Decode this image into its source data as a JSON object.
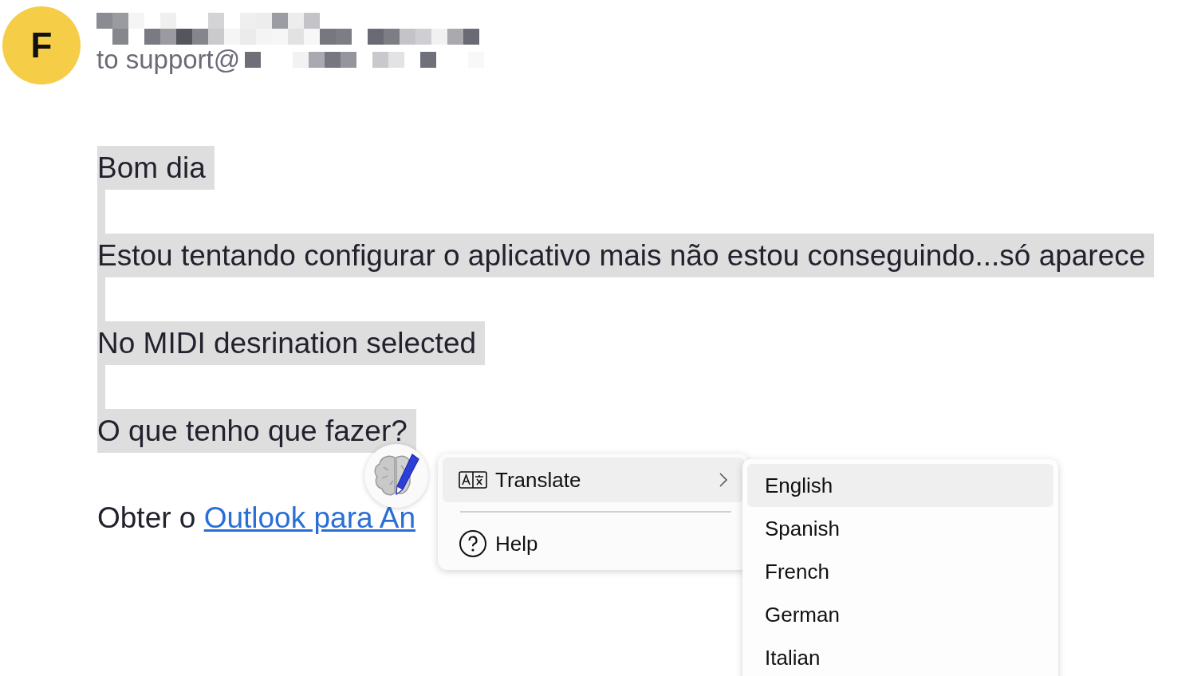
{
  "sender": {
    "avatar_letter": "F",
    "to_prefix": "to support@"
  },
  "body": {
    "lines": [
      {
        "kind": "text",
        "text": "Bom dia",
        "selected": true
      },
      {
        "kind": "blank",
        "selected": true
      },
      {
        "kind": "text",
        "text": "Estou tentando configurar o aplicativo mais não estou conseguindo...só aparece",
        "selected": true
      },
      {
        "kind": "blank",
        "selected": true
      },
      {
        "kind": "text",
        "text": "No MIDI desrination selected",
        "selected": true
      },
      {
        "kind": "blank",
        "selected": true
      },
      {
        "kind": "text",
        "text": "O que tenho que fazer?",
        "selected": true
      }
    ],
    "footer": {
      "text": "Obter o ",
      "link": "Outlook para An"
    }
  },
  "context_menu": {
    "items": [
      {
        "kind": "translate",
        "label": "Translate",
        "selected": true,
        "has_submenu": true
      },
      {
        "kind": "help",
        "label": "Help",
        "selected": false,
        "has_submenu": false
      }
    ]
  },
  "submenu": {
    "items": [
      {
        "label": "English",
        "selected": true
      },
      {
        "label": "Spanish",
        "selected": false
      },
      {
        "label": "French",
        "selected": false
      },
      {
        "label": "German",
        "selected": false
      },
      {
        "label": "Italian",
        "selected": false
      }
    ]
  }
}
